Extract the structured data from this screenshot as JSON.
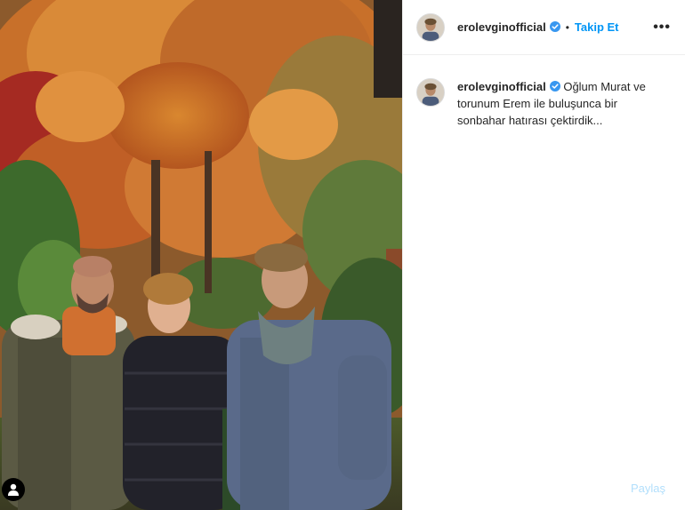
{
  "post": {
    "username": "erolevginofficial",
    "follow_label": "Takip Et",
    "separator": "•",
    "more_label": "•••",
    "caption": "Oğlum Murat ve torunum Erem ile buluşunca bir sonbahar hatırası çektirdik..."
  },
  "footer": {
    "share_label": "Paylaş"
  },
  "colors": {
    "accent": "#0095f6",
    "verified": "#3897f0",
    "text": "#262626",
    "share_disabled": "#b2dffc"
  },
  "icons": {
    "verified": "verified-badge-icon",
    "more": "more-options-icon",
    "user_tag": "user-tag-icon"
  }
}
